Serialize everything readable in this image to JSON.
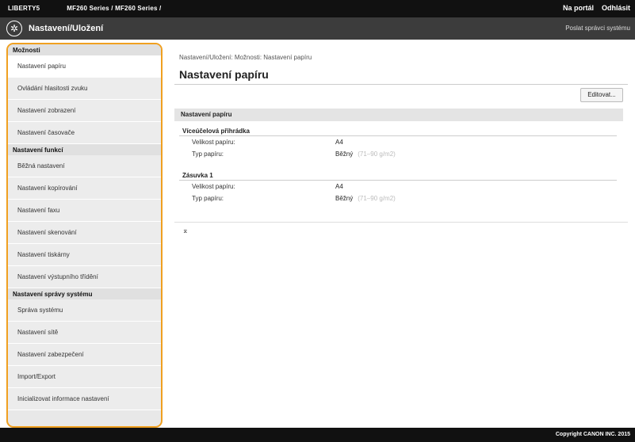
{
  "topbar": {
    "device_name": "LIBERTY5",
    "model_name": "MF260 Series / MF260 Series /",
    "portal_link": "Na portál",
    "logout_link": "Odhlásit"
  },
  "header": {
    "title": "Nastavení/Uložení",
    "system_admin_mail": "Poslat správci systému"
  },
  "sidebar": {
    "sections": [
      {
        "title": "Možnosti",
        "items": [
          {
            "label": "Nastavení papíru",
            "active": true
          },
          {
            "label": "Ovládání hlasitosti zvuku"
          },
          {
            "label": "Nastavení zobrazení"
          },
          {
            "label": "Nastavení časovače"
          }
        ]
      },
      {
        "title": "Nastavení funkcí",
        "items": [
          {
            "label": "Běžná nastavení"
          },
          {
            "label": "Nastavení kopírování"
          },
          {
            "label": "Nastavení faxu"
          },
          {
            "label": "Nastavení skenování"
          },
          {
            "label": "Nastavení tiskárny"
          },
          {
            "label": "Nastavení výstupního třídění"
          }
        ]
      },
      {
        "title": "Nastavení správy systému",
        "items": [
          {
            "label": "Správa systému"
          },
          {
            "label": "Nastavení sítě"
          },
          {
            "label": "Nastavení zabezpečení"
          },
          {
            "label": "Import/Export"
          },
          {
            "label": "Inicializovat informace nastavení"
          }
        ]
      }
    ]
  },
  "main": {
    "breadcrumb": "Nastavení/Uložení: Možnosti: Nastavení papíru",
    "page_title": "Nastavení papíru",
    "edit_button": "Editovat...",
    "section_title": "Nastavení papíru",
    "groups": [
      {
        "title": "Víceúčelová přihrádka",
        "rows": [
          {
            "label": "Velikost papíru:",
            "value": "A4",
            "extra": ""
          },
          {
            "label": "Typ papíru:",
            "value": "Běžný",
            "extra": "(71–90 g/m2)"
          }
        ]
      },
      {
        "title": "Zásuvka 1",
        "rows": [
          {
            "label": "Velikost papíru:",
            "value": "A4",
            "extra": ""
          },
          {
            "label": "Typ papíru:",
            "value": "Běžný",
            "extra": "(71–90 g/m2)"
          }
        ]
      }
    ],
    "to_top_glyph": "⌅"
  },
  "footer": {
    "copyright": "Copyright CANON INC. 2015"
  }
}
